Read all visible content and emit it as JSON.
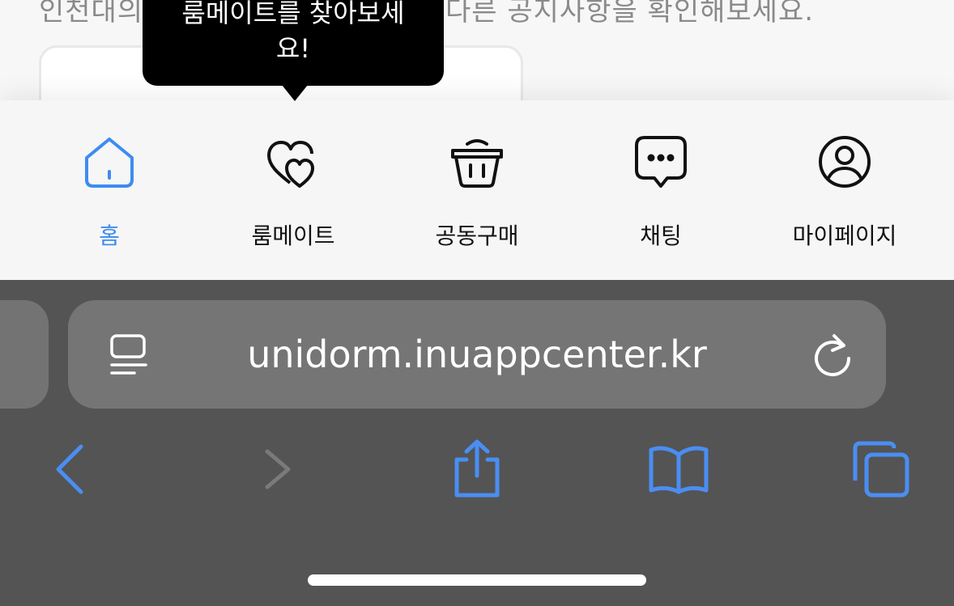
{
  "page": {
    "background_text": "인천대의 룸메이트를 찾아보세요! 다른 공지사항을 확인해보세요."
  },
  "tooltip": {
    "text_line1": "룸메이트를 찾아보세",
    "text_line2": "요!"
  },
  "tabbar": {
    "active_color": "#3d8cf0",
    "tabs": [
      {
        "label": "홈",
        "icon": "home-icon",
        "active": true
      },
      {
        "label": "룸메이트",
        "icon": "hearts-icon",
        "active": false
      },
      {
        "label": "공동구매",
        "icon": "basket-icon",
        "active": false
      },
      {
        "label": "채팅",
        "icon": "chat-bubble-icon",
        "active": false
      },
      {
        "label": "마이페이지",
        "icon": "user-circle-icon",
        "active": false
      }
    ]
  },
  "browser": {
    "url": "unidorm.inuappcenter.kr",
    "accent_color": "#4a8ef2",
    "toolbar": [
      "back-icon",
      "forward-icon",
      "share-icon",
      "bookmarks-icon",
      "tabs-icon"
    ]
  }
}
